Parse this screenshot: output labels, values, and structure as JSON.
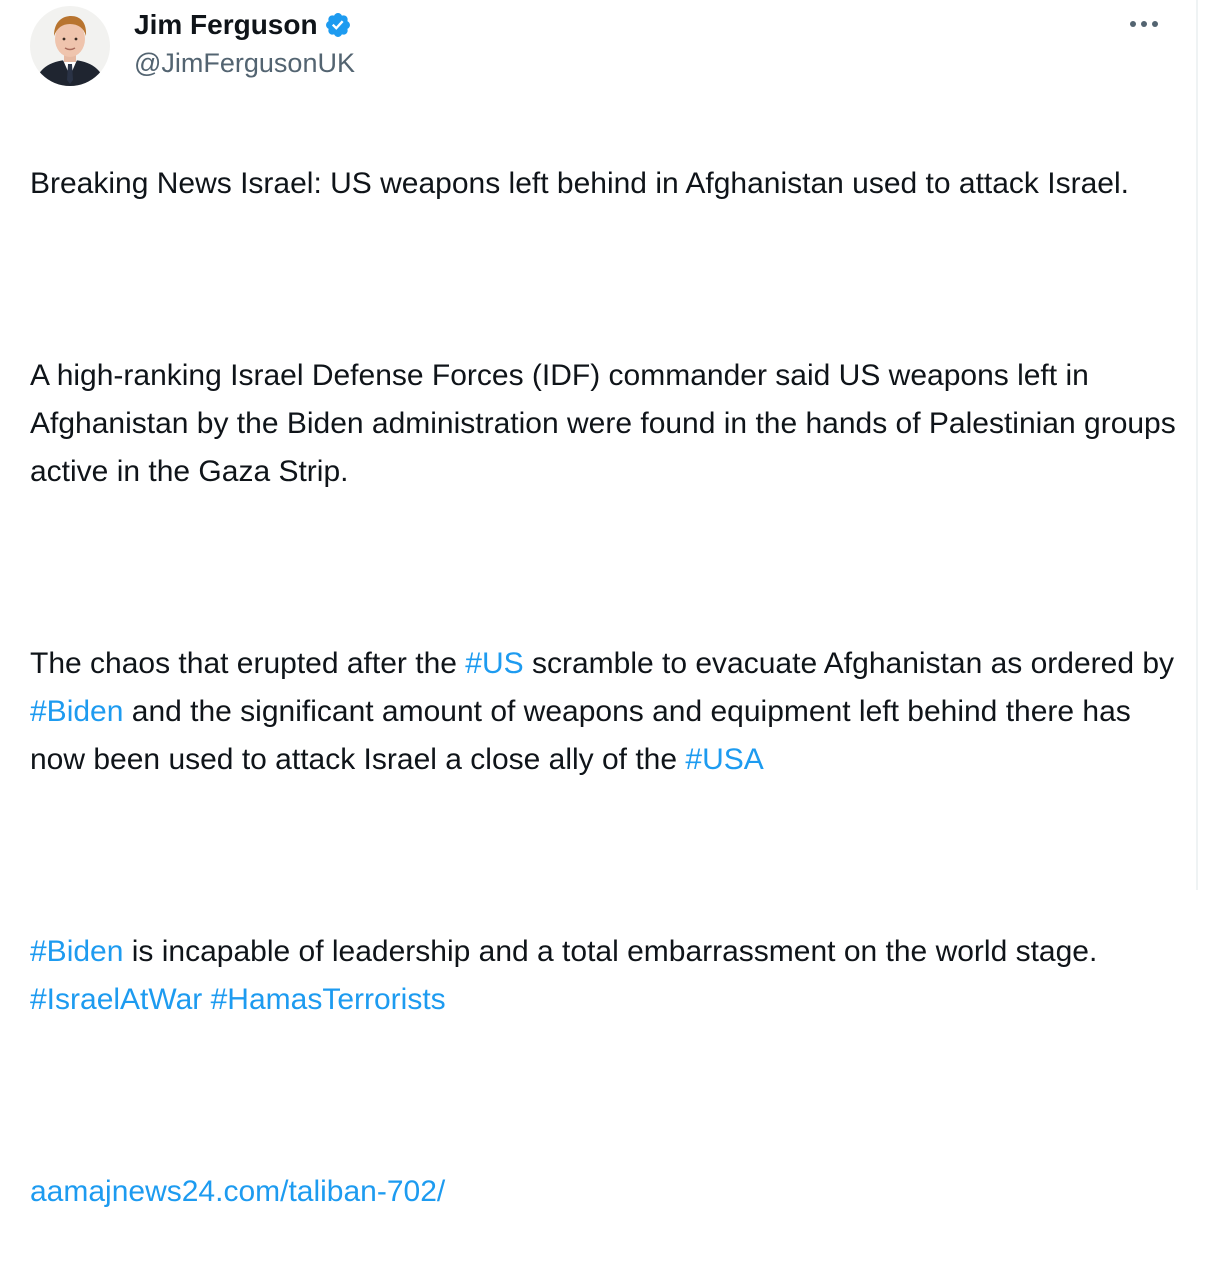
{
  "author": {
    "display_name": "Jim Ferguson",
    "handle": "@JimFergusonUK",
    "verified": true
  },
  "menu": {
    "icon": "more-horizontal-icon"
  },
  "colors": {
    "text": "#0f1419",
    "secondary": "#536471",
    "link": "#1d9bf0",
    "verified": "#1d9bf0"
  },
  "tweet": {
    "p1": "Breaking News Israel: US weapons left behind in Afghanistan used to attack Israel.",
    "p2": "A high-ranking Israel Defense Forces (IDF) commander said US weapons left in Afghanistan by the Biden administration were found in the hands of Palestinian groups active in the Gaza Strip.",
    "p3_a": "The chaos that erupted after the ",
    "p3_tag1": "#US",
    "p3_b": " scramble to evacuate Afghanistan as ordered by ",
    "p3_tag2": "#Biden",
    "p3_c": " and the significant amount of weapons and equipment left behind there has now been used to attack Israel a close ally of the ",
    "p3_tag3": "#USA",
    "p4_tag1": "#Biden",
    "p4_a": " is incapable of leadership and a total embarrassment on the world stage. ",
    "p4_tag2": "#IsraelAtWar",
    "p4_b": " ",
    "p4_tag3": "#HamasTerrorists",
    "link": "aamajnews24.com/taliban-702/"
  }
}
